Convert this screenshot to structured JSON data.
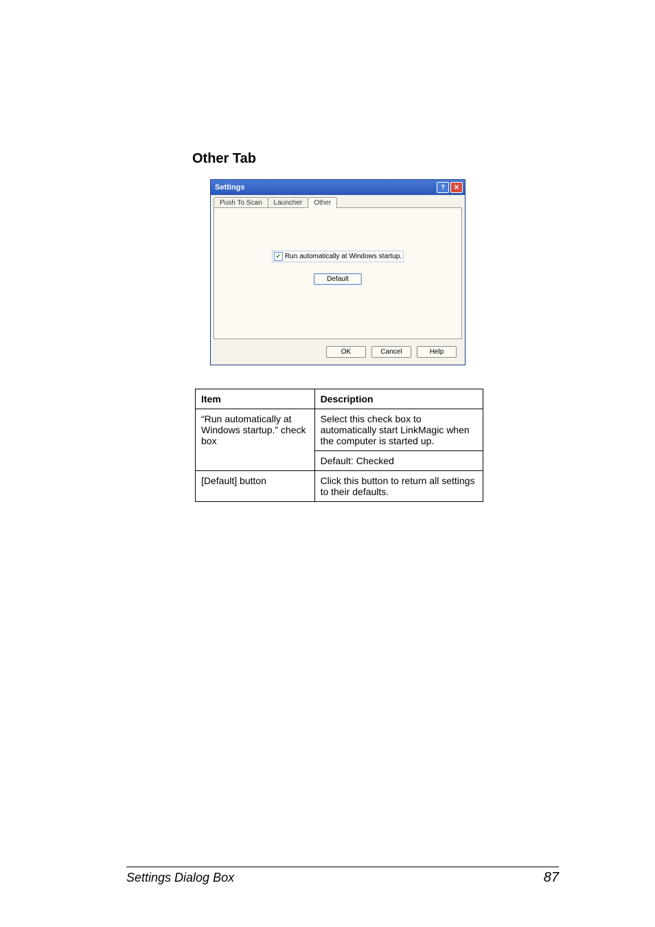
{
  "heading": "Other Tab",
  "dialog": {
    "title": "Settings",
    "help_glyph": "?",
    "close_glyph": "✕",
    "tabs": {
      "push": "Push To Scan",
      "launcher": "Launcher",
      "other": "Other"
    },
    "checkbox_label": "Run automatically at Windows startup.",
    "checkbox_mark": "✔",
    "default_btn": "Default",
    "buttons": {
      "ok": "OK",
      "cancel": "Cancel",
      "help": "Help"
    }
  },
  "table": {
    "head_item": "Item",
    "head_desc": "Description",
    "row1_item": "“Run automatically at Windows startup.” check box",
    "row1_desc": "Select this check box to automatically start LinkMagic when the computer is started up.",
    "row1_default": "Default: Checked",
    "row2_item": "[Default] button",
    "row2_desc": "Click this button to return all settings to their defaults."
  },
  "footer": {
    "title": "Settings Dialog Box",
    "page": "87"
  }
}
